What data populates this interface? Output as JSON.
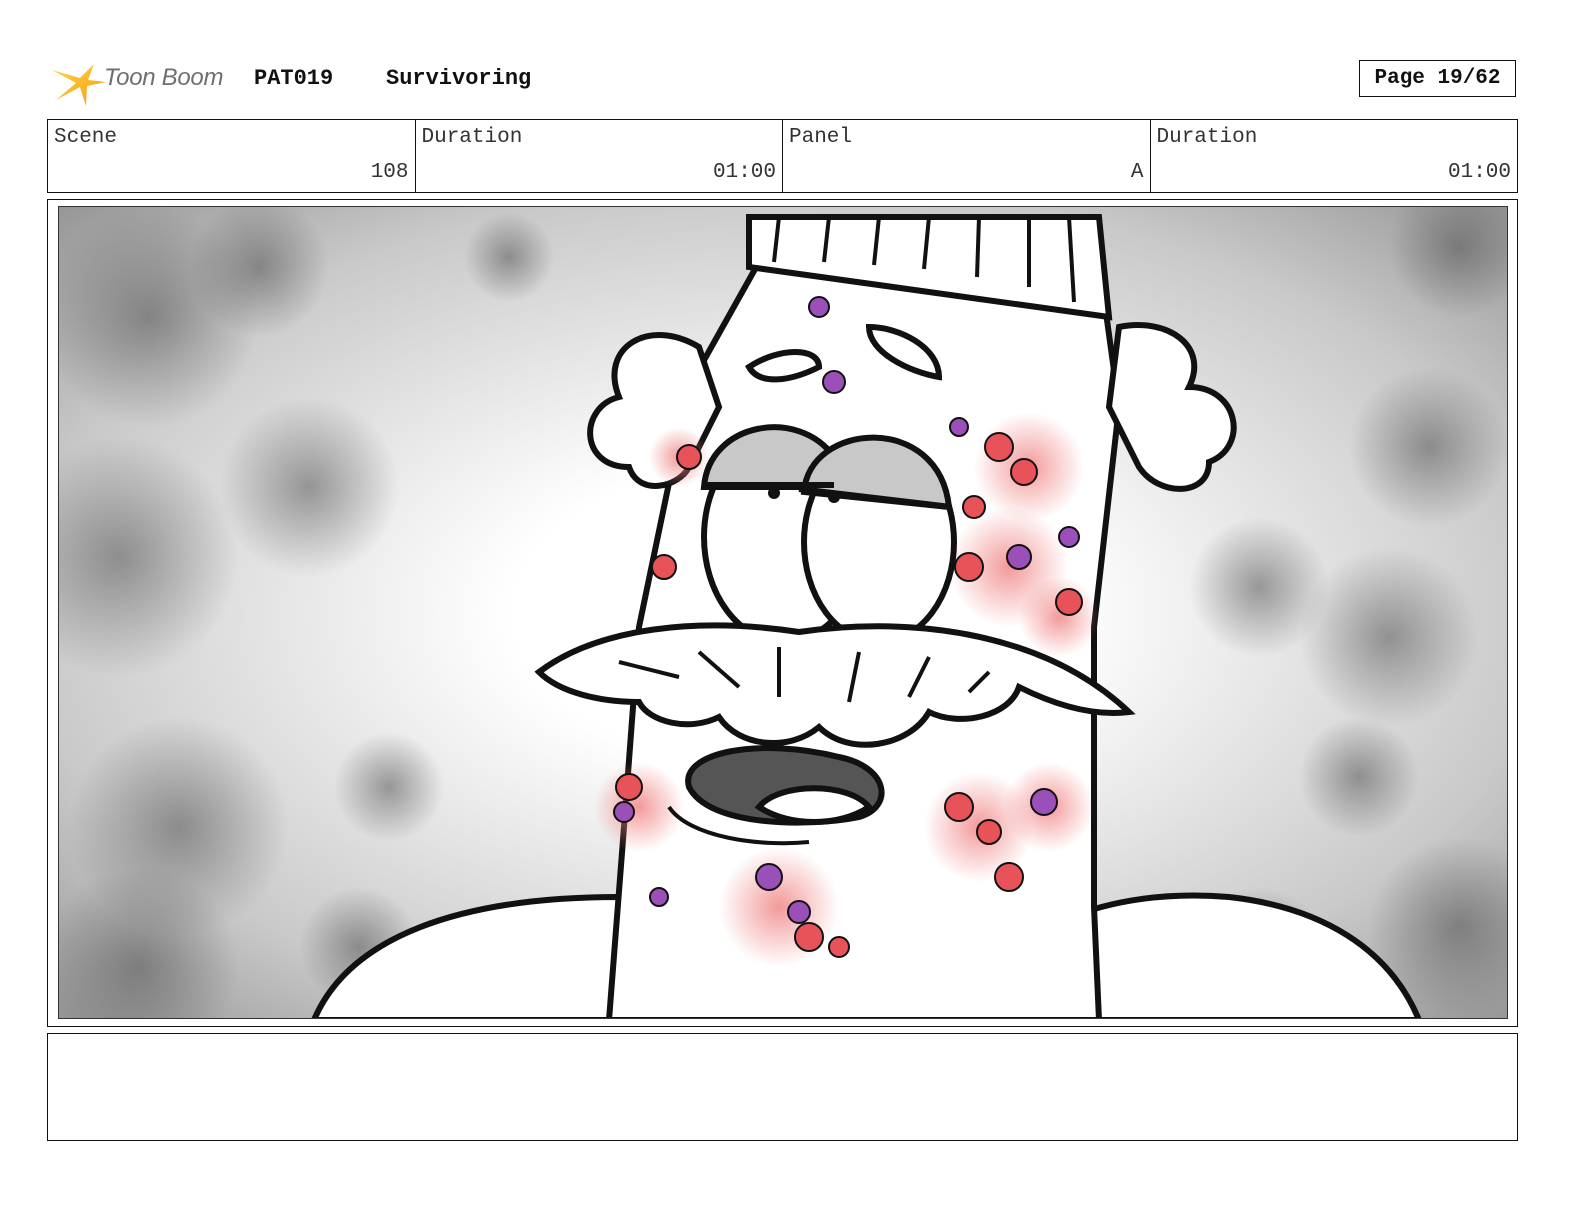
{
  "header": {
    "logo_text": "Toon Boom",
    "project_code": "PAT019",
    "project_title": "Survivoring",
    "page_label": "Page 19/62"
  },
  "info": {
    "scene_label": "Scene",
    "scene_value": "108",
    "scene_duration_label": "Duration",
    "scene_duration_value": "01:00",
    "panel_label": "Panel",
    "panel_value": "A",
    "panel_duration_label": "Duration",
    "panel_duration_value": "01:00"
  },
  "panel": {
    "image_icon": "storyboard-drawing-icon"
  },
  "notes": {
    "text": ""
  },
  "colors": {
    "logo_yellow": "#f5c20f",
    "logo_orange": "#f59a0f",
    "rash_red": "#e8535a",
    "rash_purple": "#9b4fb8"
  }
}
